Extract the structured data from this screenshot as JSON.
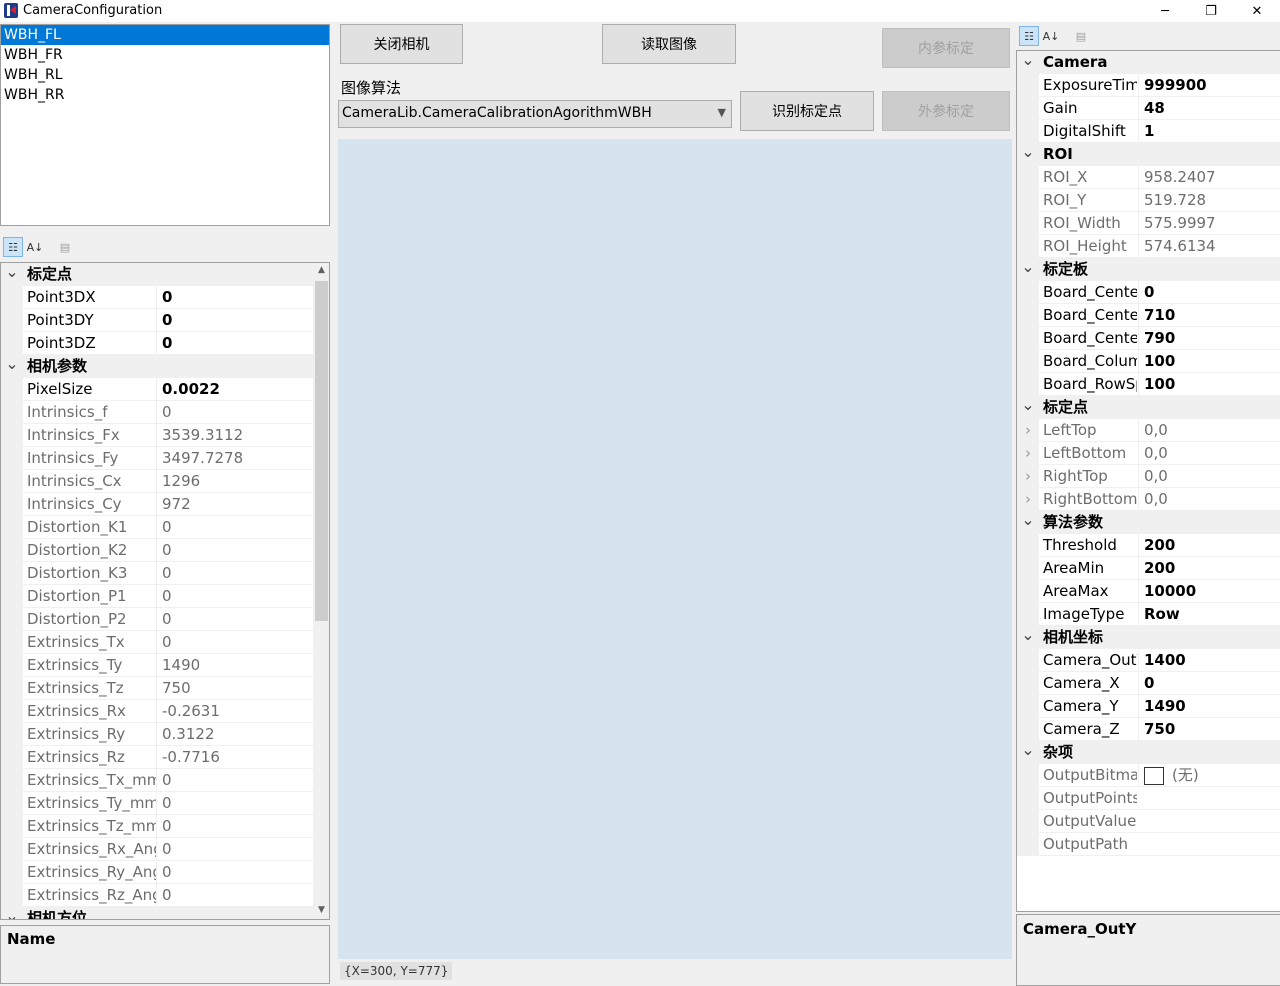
{
  "window": {
    "title": "CameraConfiguration",
    "minimize_glyph": "─",
    "maximize_glyph": "❐",
    "close_glyph": "✕"
  },
  "camera_list": [
    "WBH_FL",
    "WBH_FR",
    "WBH_RL",
    "WBH_RR"
  ],
  "left_grid": {
    "toolbar": {
      "categorized_glyph": "☷",
      "alphabetical_glyph": "A↓",
      "pages_glyph": "▤"
    },
    "rows": [
      {
        "type": "cat",
        "name": "标定点"
      },
      {
        "name": "Point3DX",
        "value": "0",
        "bold": true
      },
      {
        "name": "Point3DY",
        "value": "0",
        "bold": true
      },
      {
        "name": "Point3DZ",
        "value": "0",
        "bold": true
      },
      {
        "type": "cat",
        "name": "相机参数"
      },
      {
        "name": "PixelSize",
        "value": "0.0022",
        "bold": true
      },
      {
        "name": "Intrinsics_f",
        "value": "0",
        "ro": true
      },
      {
        "name": "Intrinsics_Fx",
        "value": "3539.3112",
        "ro": true
      },
      {
        "name": "Intrinsics_Fy",
        "value": "3497.7278",
        "ro": true
      },
      {
        "name": "Intrinsics_Cx",
        "value": "1296",
        "ro": true
      },
      {
        "name": "Intrinsics_Cy",
        "value": "972",
        "ro": true
      },
      {
        "name": "Distortion_K1",
        "value": "0",
        "ro": true
      },
      {
        "name": "Distortion_K2",
        "value": "0",
        "ro": true
      },
      {
        "name": "Distortion_K3",
        "value": "0",
        "ro": true
      },
      {
        "name": "Distortion_P1",
        "value": "0",
        "ro": true
      },
      {
        "name": "Distortion_P2",
        "value": "0",
        "ro": true
      },
      {
        "name": "Extrinsics_Tx",
        "value": "0",
        "ro": true
      },
      {
        "name": "Extrinsics_Ty",
        "value": "1490",
        "ro": true
      },
      {
        "name": "Extrinsics_Tz",
        "value": "750",
        "ro": true
      },
      {
        "name": "Extrinsics_Rx",
        "value": "-0.2631",
        "ro": true
      },
      {
        "name": "Extrinsics_Ry",
        "value": "0.3122",
        "ro": true
      },
      {
        "name": "Extrinsics_Rz",
        "value": "-0.7716",
        "ro": true
      },
      {
        "name": "Extrinsics_Tx_mm",
        "value": "0",
        "ro": true
      },
      {
        "name": "Extrinsics_Ty_mm",
        "value": "0",
        "ro": true
      },
      {
        "name": "Extrinsics_Tz_mm",
        "value": "0",
        "ro": true
      },
      {
        "name": "Extrinsics_Rx_Ang",
        "value": "0",
        "ro": true
      },
      {
        "name": "Extrinsics_Ry_Ang",
        "value": "0",
        "ro": true
      },
      {
        "name": "Extrinsics_Rz_Ang",
        "value": "0",
        "ro": true
      },
      {
        "type": "cat",
        "name": "相机方位"
      }
    ],
    "description_title": "Name"
  },
  "toolbar": {
    "close_camera": "关闭相机",
    "read_image": "读取图像",
    "intrinsic_calib": "内参标定",
    "algo_label": "图像算法",
    "algo_selected": "CameraLib.CameraCalibrationAgorithmWBH",
    "detect_points": "识别标定点",
    "extrinsic_calib": "外参标定"
  },
  "image_view": {
    "coord_readout": "{X=300, Y=777}"
  },
  "right_grid": {
    "rows": [
      {
        "type": "cat",
        "name": "Camera"
      },
      {
        "name": "ExposureTime",
        "value": "999900",
        "bold": true
      },
      {
        "name": "Gain",
        "value": "48",
        "bold": true
      },
      {
        "name": "DigitalShift",
        "value": "1",
        "bold": true
      },
      {
        "type": "cat",
        "name": "ROI"
      },
      {
        "name": "ROI_X",
        "value": "958.2407",
        "ro": true
      },
      {
        "name": "ROI_Y",
        "value": "519.728",
        "ro": true
      },
      {
        "name": "ROI_Width",
        "value": "575.9997",
        "ro": true
      },
      {
        "name": "ROI_Height",
        "value": "574.6134",
        "ro": true
      },
      {
        "type": "cat",
        "name": "标定板"
      },
      {
        "name": "Board_CenterX",
        "value": "0",
        "bold": true
      },
      {
        "name": "Board_CenterY",
        "value": "710",
        "bold": true
      },
      {
        "name": "Board_CenterZ",
        "value": "790",
        "bold": true
      },
      {
        "name": "Board_ColumnSpace",
        "value": "100",
        "bold": true
      },
      {
        "name": "Board_RowSpace",
        "value": "100",
        "bold": true
      },
      {
        "type": "cat",
        "name": "标定点"
      },
      {
        "name": "LeftTop",
        "value": "0,0",
        "ro": true,
        "expand": true
      },
      {
        "name": "LeftBottom",
        "value": "0,0",
        "ro": true,
        "expand": true
      },
      {
        "name": "RightTop",
        "value": "0,0",
        "ro": true,
        "expand": true
      },
      {
        "name": "RightBottom",
        "value": "0,0",
        "ro": true,
        "expand": true
      },
      {
        "type": "cat",
        "name": "算法参数"
      },
      {
        "name": "Threshold",
        "value": "200",
        "bold": true
      },
      {
        "name": "AreaMin",
        "value": "200",
        "bold": true
      },
      {
        "name": "AreaMax",
        "value": "10000",
        "bold": true
      },
      {
        "name": "ImageType",
        "value": "Row",
        "bold": true
      },
      {
        "type": "cat",
        "name": "相机坐标"
      },
      {
        "name": "Camera_OutY",
        "value": "1400",
        "bold": true
      },
      {
        "name": "Camera_X",
        "value": "0",
        "bold": true
      },
      {
        "name": "Camera_Y",
        "value": "1490",
        "bold": true
      },
      {
        "name": "Camera_Z",
        "value": "750",
        "bold": true
      },
      {
        "type": "cat",
        "name": "杂项"
      },
      {
        "name": "OutputBitmap",
        "value": "(无)",
        "ro": true,
        "swatch": true
      },
      {
        "name": "OutputPoints",
        "value": "",
        "ro": true
      },
      {
        "name": "OutputValue",
        "value": "",
        "ro": true
      },
      {
        "name": "OutputPath",
        "value": "",
        "ro": true
      }
    ],
    "description_title": "Camera_OutY"
  }
}
